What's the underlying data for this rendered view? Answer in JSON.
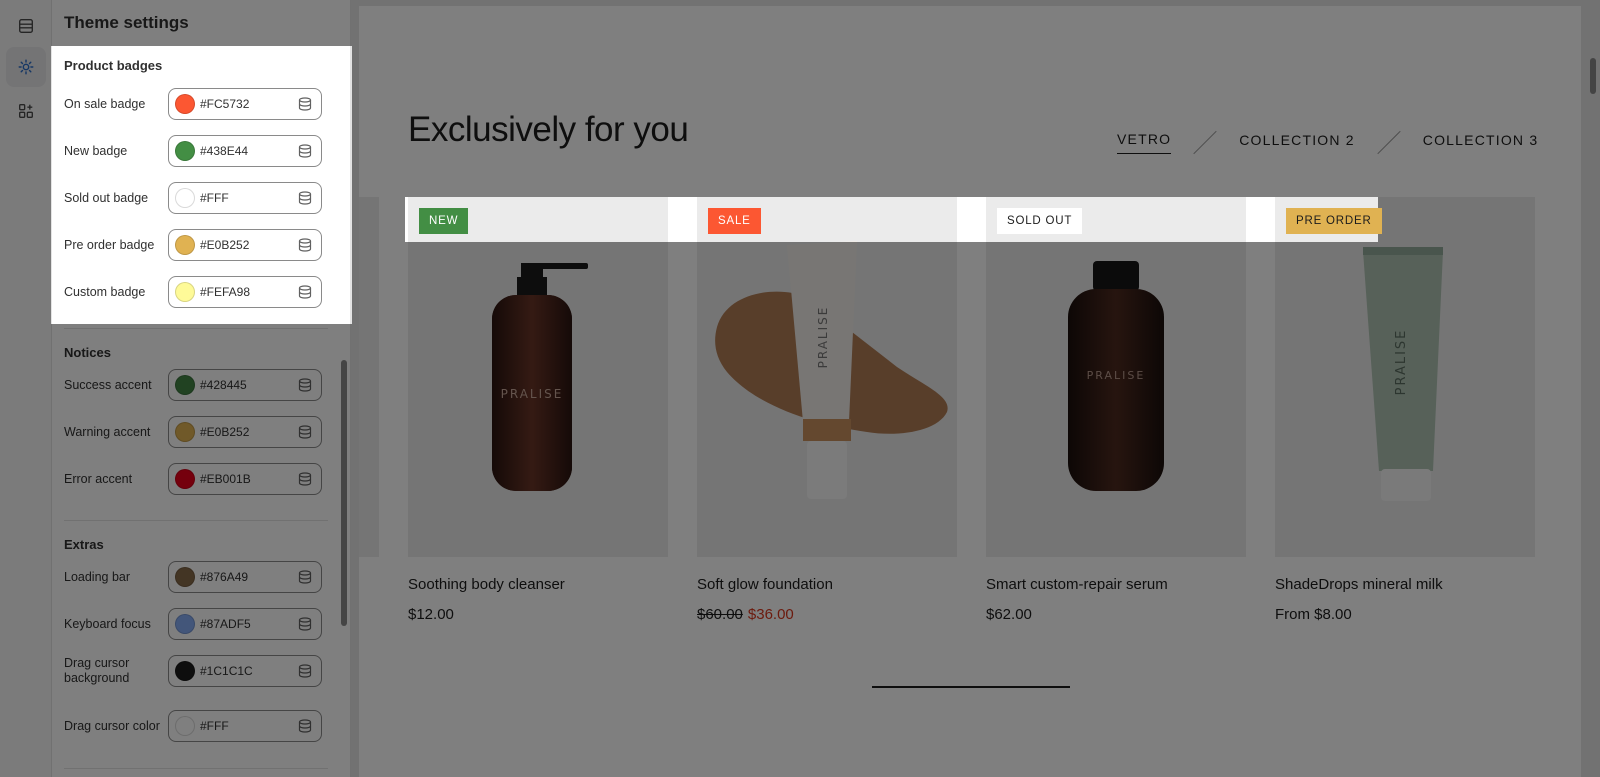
{
  "panel": {
    "title": "Theme settings",
    "sections": {
      "product_badges": {
        "title": "Product badges",
        "rows": [
          {
            "label": "On sale badge",
            "hex": "#FC5732",
            "color": "#FC5732"
          },
          {
            "label": "New badge",
            "hex": "#438E44",
            "color": "#438E44"
          },
          {
            "label": "Sold out badge",
            "hex": "#FFF",
            "color": "#FFFFFF"
          },
          {
            "label": "Pre order badge",
            "hex": "#E0B252",
            "color": "#E0B252"
          },
          {
            "label": "Custom badge",
            "hex": "#FEFA98",
            "color": "#FEFA98"
          }
        ]
      },
      "notices": {
        "title": "Notices",
        "rows": [
          {
            "label": "Success accent",
            "hex": "#428445",
            "color": "#428445"
          },
          {
            "label": "Warning accent",
            "hex": "#E0B252",
            "color": "#E0B252"
          },
          {
            "label": "Error accent",
            "hex": "#EB001B",
            "color": "#EB001B"
          }
        ]
      },
      "extras": {
        "title": "Extras",
        "rows": [
          {
            "label": "Loading bar",
            "hex": "#876A49",
            "color": "#876A49"
          },
          {
            "label": "Keyboard focus",
            "hex": "#87ADF5",
            "color": "#87ADF5"
          },
          {
            "label": "Drag cursor background",
            "hex": "#1C1C1C",
            "color": "#1C1C1C"
          },
          {
            "label": "Drag cursor color",
            "hex": "#FFF",
            "color": "#FFFFFF"
          }
        ]
      }
    }
  },
  "preview": {
    "heading": "Exclusively for you",
    "tabs": [
      "VETRO",
      "COLLECTION 2",
      "COLLECTION 3"
    ],
    "products": [
      {
        "badge": "NEW",
        "badge_bg": "#438E44",
        "badge_fg": "#FFFFFF",
        "name": "Soothing body cleanser",
        "price": "$12.00",
        "brand": "PRALISE"
      },
      {
        "badge": "SALE",
        "badge_bg": "#FC5732",
        "badge_fg": "#FFFFFF",
        "name": "Soft glow foundation",
        "old_price": "$60.00",
        "price": "$36.00",
        "brand": "PRALISE"
      },
      {
        "badge": "SOLD OUT",
        "badge_bg": "#FFFFFF",
        "badge_fg": "#1C1C1C",
        "name": "Smart custom-repair serum",
        "price": "$62.00",
        "brand": "PRALISE"
      },
      {
        "badge": "PRE ORDER",
        "badge_bg": "#E0B252",
        "badge_fg": "#1C1C1C",
        "name": "ShadeDrops mineral milk",
        "price": "From $8.00",
        "brand": "PRALISE"
      }
    ]
  },
  "icons": {
    "rail": [
      "sections-icon",
      "gear-icon",
      "apps-icon"
    ],
    "row_action": "database-icon"
  },
  "colors": {
    "accent": "#2C6ECB",
    "overlay": "rgba(0,0,0,0.5)"
  }
}
